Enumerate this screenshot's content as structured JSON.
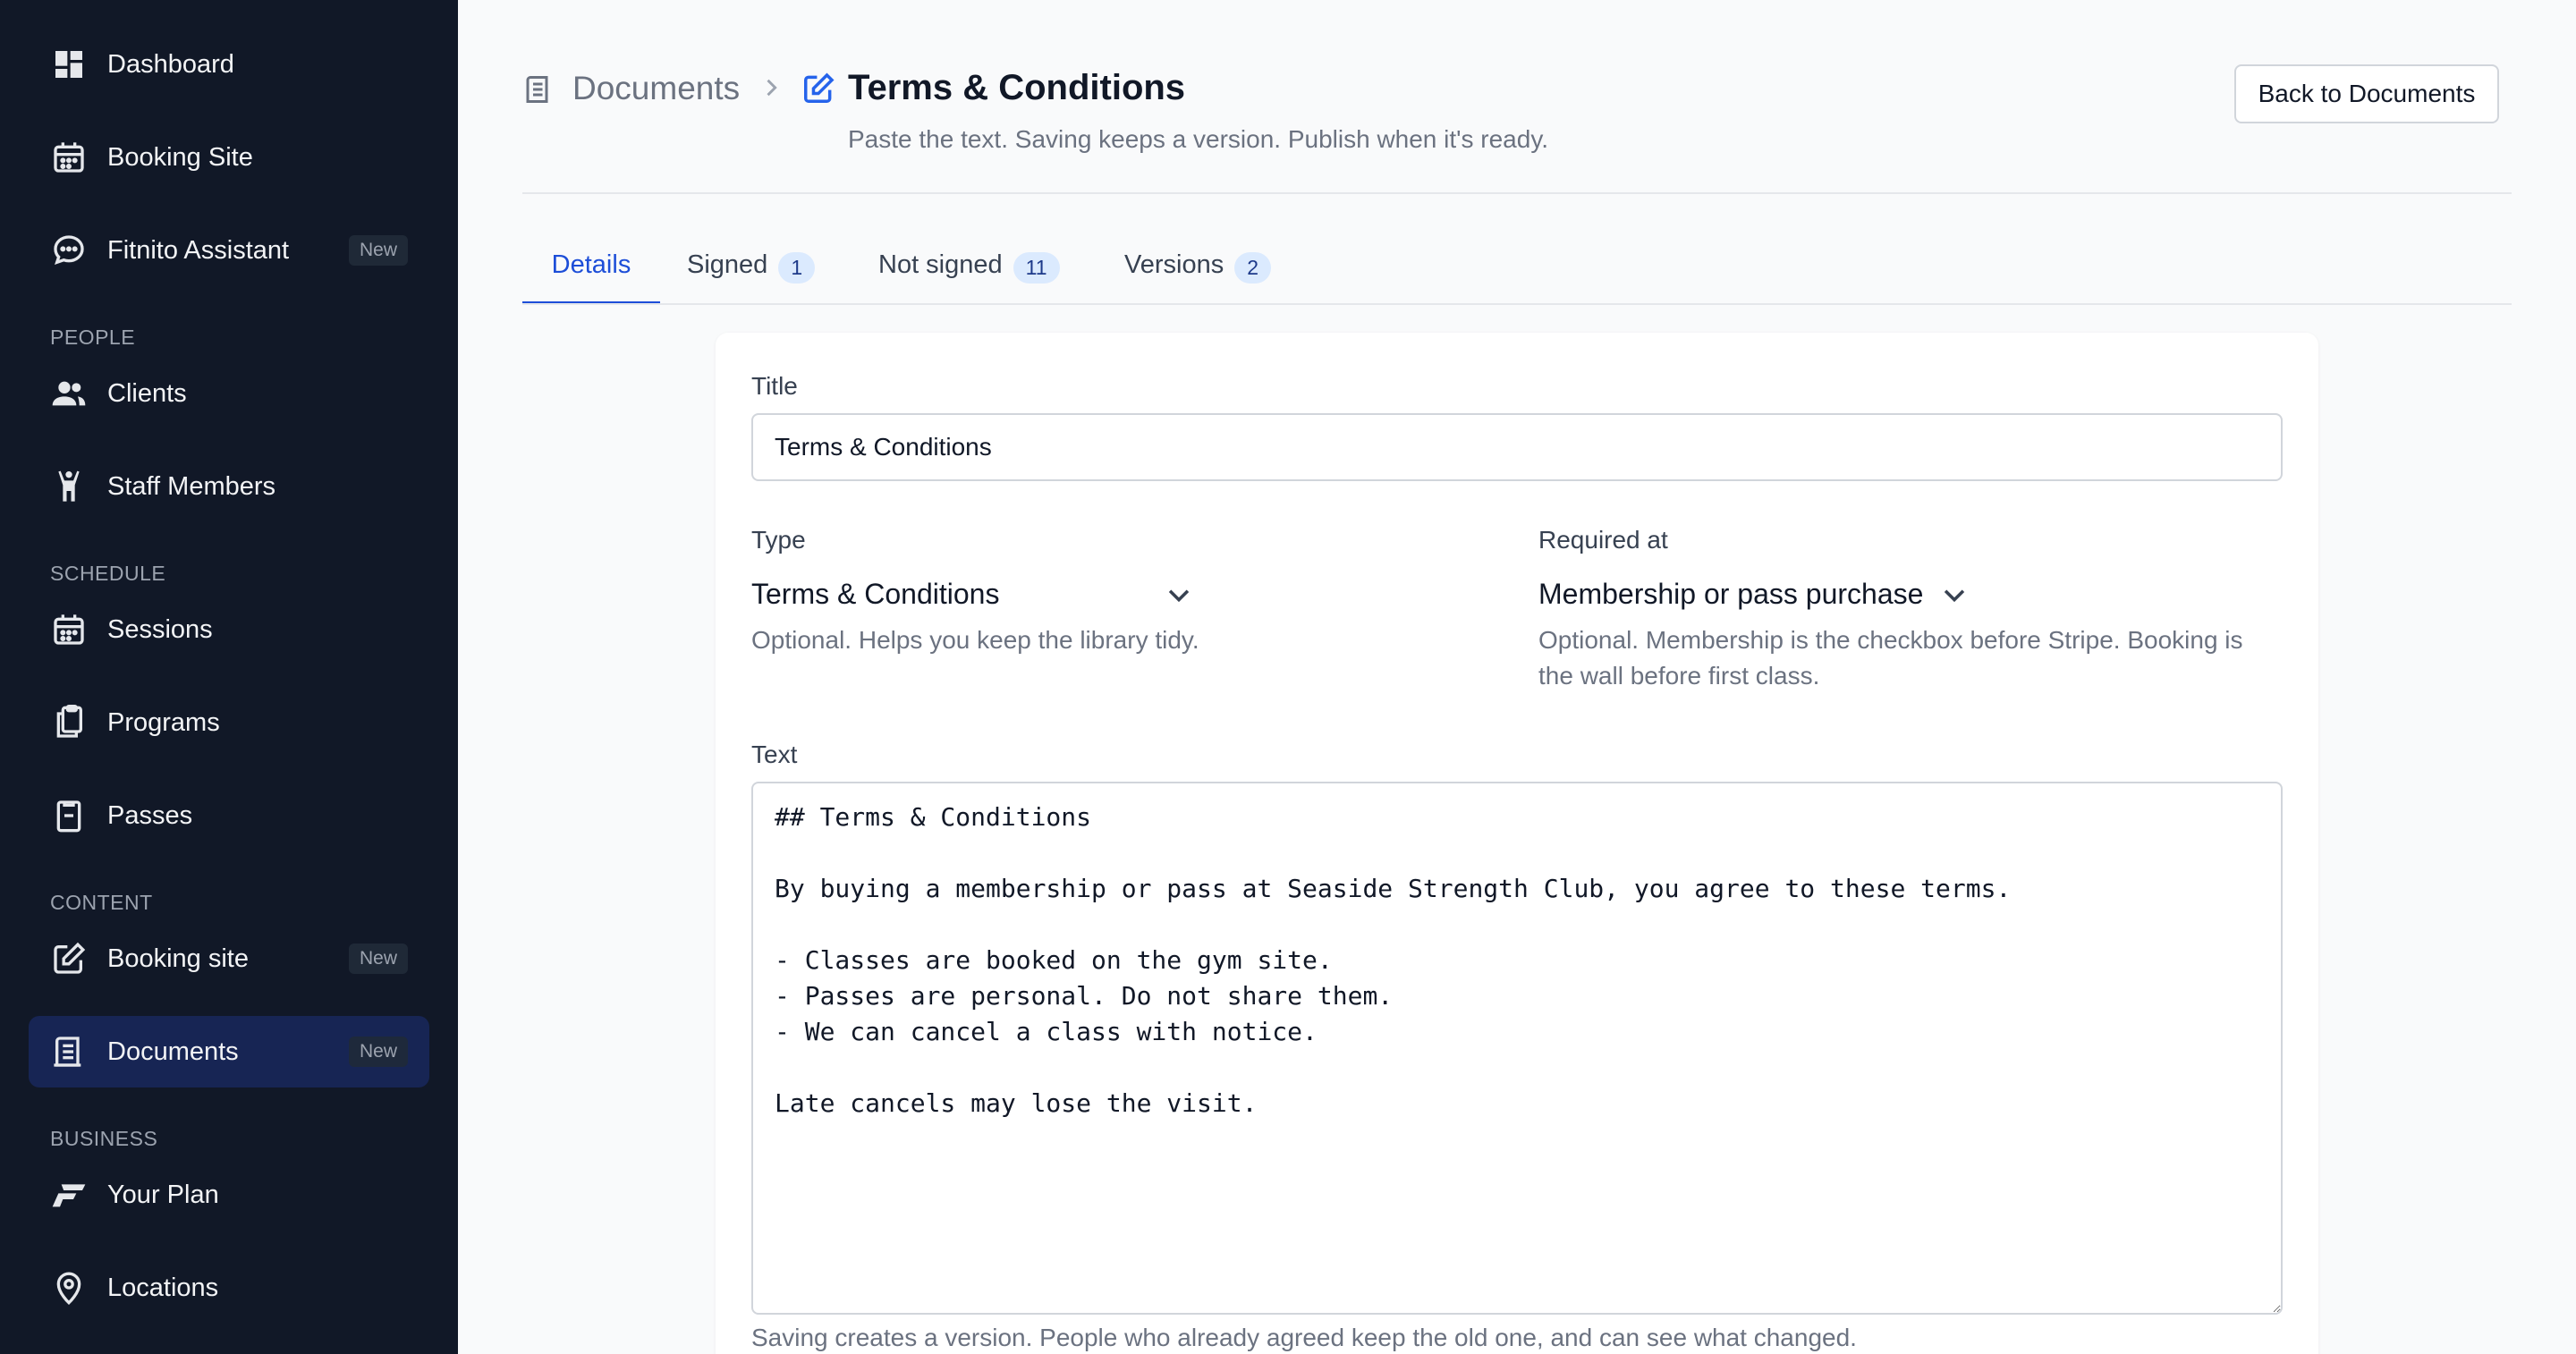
{
  "sidebar": {
    "items": {
      "dashboard": {
        "label": "Dashboard",
        "icon": "dashboard-icon"
      },
      "booking_site_top": {
        "label": "Booking Site",
        "icon": "calendar-icon"
      },
      "assistant": {
        "label": "Fitnito Assistant",
        "icon": "chat-icon",
        "badge": "New"
      },
      "clients": {
        "label": "Clients",
        "icon": "users-icon"
      },
      "staff": {
        "label": "Staff Members",
        "icon": "person-icon"
      },
      "sessions": {
        "label": "Sessions",
        "icon": "calendar-icon"
      },
      "programs": {
        "label": "Programs",
        "icon": "clipboard-icon"
      },
      "passes": {
        "label": "Passes",
        "icon": "pass-icon"
      },
      "booking_site": {
        "label": "Booking site",
        "icon": "edit-icon",
        "badge": "New"
      },
      "documents": {
        "label": "Documents",
        "icon": "document-icon",
        "badge": "New"
      },
      "plan": {
        "label": "Your Plan",
        "icon": "fitnito-logo-icon"
      },
      "locations": {
        "label": "Locations",
        "icon": "map-pin-icon"
      }
    },
    "sections": {
      "people": "PEOPLE",
      "schedule": "SCHEDULE",
      "content": "CONTENT",
      "business": "BUSINESS"
    }
  },
  "header": {
    "breadcrumb_parent": "Documents",
    "title": "Terms & Conditions",
    "subtitle": "Paste the text. Saving keeps a version. Publish when it's ready.",
    "back_label": "Back to Documents"
  },
  "tabs": {
    "details": {
      "label": "Details"
    },
    "signed": {
      "label": "Signed",
      "count": "1"
    },
    "not_signed": {
      "label": "Not signed",
      "count": "11"
    },
    "versions": {
      "label": "Versions",
      "count": "2"
    }
  },
  "form": {
    "title_label": "Title",
    "title_value": "Terms & Conditions",
    "type_label": "Type",
    "type_value": "Terms & Conditions",
    "type_help": "Optional. Helps you keep the library tidy.",
    "required_label": "Required at",
    "required_value": "Membership or pass purchase",
    "required_help_1": "Optional. Membership is the checkbox before Stripe. Booking is",
    "required_help_2": "the wall before first class.",
    "text_label": "Text",
    "text_value": "## Terms & Conditions\n\nBy buying a membership or pass at Seaside Strength Club, you agree to these terms.\n\n- Classes are booked on the gym site.\n- Passes are personal. Do not share them.\n- We can cancel a class with notice.\n\nLate cancels may lose the visit.",
    "text_help": "Saving creates a version. People who already agreed keep the old one, and can see what changed."
  },
  "colors": {
    "sidebar_bg": "#111827",
    "active_bg": "#172554",
    "accent": "#1d4ed8",
    "badge_bg": "#dbeafe"
  }
}
